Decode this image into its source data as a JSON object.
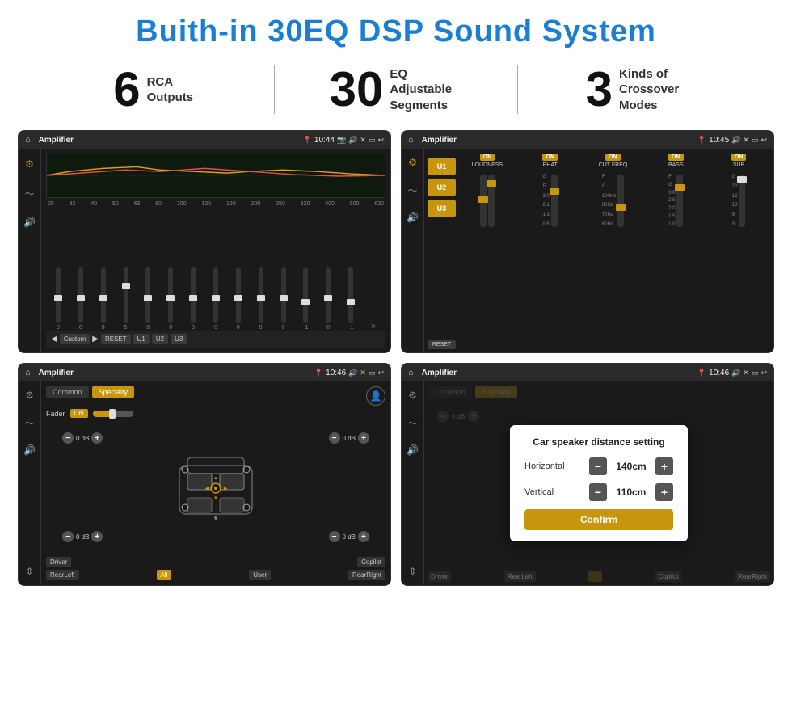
{
  "page": {
    "title": "Buith-in 30EQ DSP Sound System",
    "title_color": "#1a7fd4"
  },
  "stats": {
    "items": [
      {
        "number": "6",
        "text": "RCA\nOutputs"
      },
      {
        "number": "30",
        "text": "EQ Adjustable\nSegments"
      },
      {
        "number": "3",
        "text": "Kinds of\nCrossover Modes"
      }
    ]
  },
  "screen1": {
    "status": {
      "app": "Amplifier",
      "time": "10:44"
    },
    "eq_labels": [
      "25",
      "32",
      "40",
      "50",
      "63",
      "80",
      "100",
      "125",
      "160",
      "200",
      "250",
      "320",
      "400",
      "500",
      "630"
    ],
    "eq_values": [
      "0",
      "0",
      "0",
      "5",
      "0",
      "0",
      "0",
      "0",
      "0",
      "0",
      "0",
      "-1",
      "0",
      "-1"
    ],
    "bottom_buttons": [
      "Custom",
      "RESET",
      "U1",
      "U2",
      "U3"
    ]
  },
  "screen2": {
    "status": {
      "app": "Amplifier",
      "time": "10:45"
    },
    "channels": [
      "LOUDNESS",
      "PHAT",
      "CUT FREQ",
      "BASS",
      "SUB"
    ],
    "u_buttons": [
      "U1",
      "U2",
      "U3"
    ],
    "reset_label": "RESET"
  },
  "screen3": {
    "status": {
      "app": "Amplifier",
      "time": "10:46"
    },
    "tabs": [
      "Common",
      "Specialty"
    ],
    "active_tab": "Specialty",
    "fader_label": "Fader",
    "fader_on": "ON",
    "speaker_zones": {
      "top_left": "0 dB",
      "top_right": "0 dB",
      "bottom_left": "0 dB",
      "bottom_right": "0 dB"
    },
    "bottom_buttons": [
      "Driver",
      "All",
      "User",
      "RearLeft",
      "Copilot",
      "RearRight"
    ]
  },
  "screen4": {
    "status": {
      "app": "Amplifier",
      "time": "10:46"
    },
    "tabs": [
      "Common",
      "Specialty"
    ],
    "dialog": {
      "title": "Car speaker distance setting",
      "horizontal_label": "Horizontal",
      "horizontal_value": "140cm",
      "vertical_label": "Vertical",
      "vertical_value": "110cm",
      "confirm_label": "Confirm"
    },
    "bottom_buttons": [
      "Driver",
      "RearLeft",
      "Copilot",
      "RearRight"
    ]
  }
}
